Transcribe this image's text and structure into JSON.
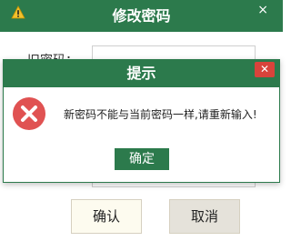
{
  "window": {
    "title": "修改密码",
    "label_partial": "旧密码：",
    "close_glyph": "×",
    "confirm_label": "确认",
    "cancel_label": "取消"
  },
  "dialog": {
    "title": "提示",
    "close_glyph": "✕",
    "message": "新密码不能与当前密码一样,请重新输入!",
    "ok_label": "确定"
  },
  "colors": {
    "titlebar": "#2c7a4c",
    "error": "#e05252",
    "close_button": "#d9433b"
  },
  "icons": {
    "warning": "warning-icon",
    "error": "error-icon",
    "close": "close-icon"
  }
}
